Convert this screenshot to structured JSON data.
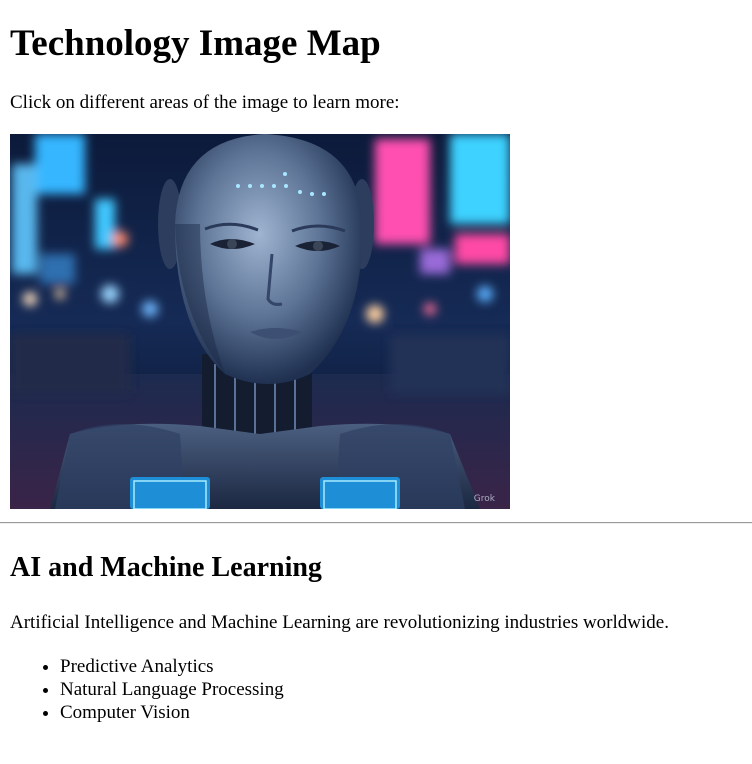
{
  "page": {
    "title": "Technology Image Map",
    "intro": "Click on different areas of the image to learn more:"
  },
  "image": {
    "description": "robot-portrait",
    "watermark": "Grok"
  },
  "section": {
    "heading": "AI and Machine Learning",
    "description": "Artificial Intelligence and Machine Learning are revolutionizing industries worldwide.",
    "items": [
      "Predictive Analytics",
      "Natural Language Processing",
      "Computer Vision"
    ]
  }
}
